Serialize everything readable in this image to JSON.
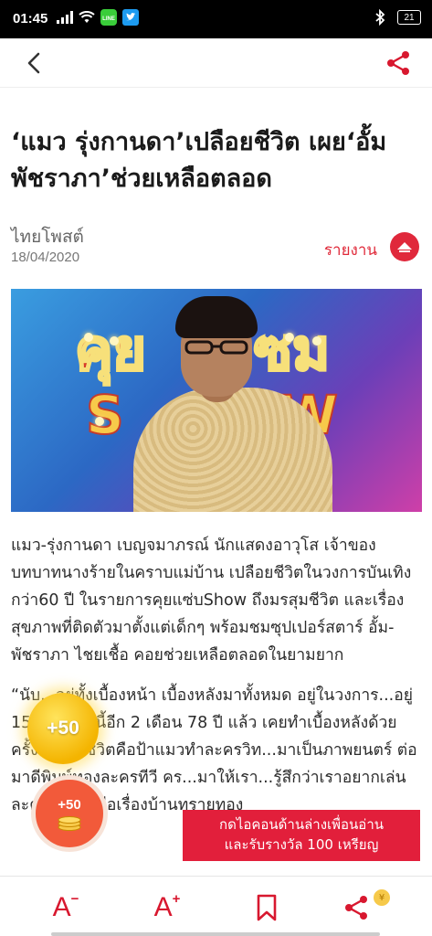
{
  "status_bar": {
    "time": "01:45",
    "battery": "21"
  },
  "header": {
    "back_icon": "chevron-left-icon",
    "share_icon": "share-icon"
  },
  "article": {
    "headline": "‘แมว รุ่งกานดา’เปลือยชีวิต เผย‘อั้ม พัชราภา’ช่วยเหลือตลอด",
    "source": "ไทยโพสต์",
    "date": "18/04/2020",
    "report_label": "รายงาน",
    "paragraphs": [
      "แมว-รุ่งกานดา เบญจมาภรณ์ นักแสดงอาวุโส เจ้าของบทบาทนางร้ายในคราบแม่บ้าน เปลือยชีวิตในวงการบันเทิงกว่า60 ปี ในรายการคุยแซ่บShow ถึงมรสุมชีวิต และเรื่องสุขภาพที่ติดตัวมาตั้งแต่เด็กๆ พร้อมชมซุปเปอร์สตาร์ อั้ม-พัชราภา ไชยเชื้อ คอยช่วยเหลือตลอดในยามยาก",
      "“นับ...อยู่ทั้งเบื้องหน้า เบื้องหลังมาทั้งหมด อยู่ในวงการ...อยู่ 15 อายุตอนนี้อีก 2 เดือน 78 ปี แล้ว เคยทำเบื้องหลังด้วย ครั้งแรกในชีวิตคือป้าแมวทำละครวิท...มาเป็นภาพยนตร์ ต่อมาดีพิมพ์ทองละครทีวี คร...มาให้เรา...รู้สึกว่าเราอยากเล่นละครเรื่องนี้ คือเรื่องบ้านทรายทอง"
    ]
  },
  "rewards": {
    "coin_bonus_1": "+50",
    "coin_bonus_2": "+50",
    "banner_line1": "กดไอคอนด้านล่างเพื่อนอ่าน",
    "banner_line2": "และรับรางวัล 100 เหรียญ"
  },
  "toolbar": {
    "font_decrease": "A",
    "font_decrease_sup": "−",
    "font_increase": "A",
    "font_increase_sup": "+",
    "bookmark_icon": "bookmark-icon",
    "share_icon": "share-icon",
    "coin_badge": "¥"
  },
  "hero_image": {
    "sign_text": "คุยแซ่บ SHOW"
  },
  "colors": {
    "accent": "#e0283b",
    "status_bar": "#000000",
    "coin_gold": "#f4b400",
    "banner": "#e21f3b"
  }
}
